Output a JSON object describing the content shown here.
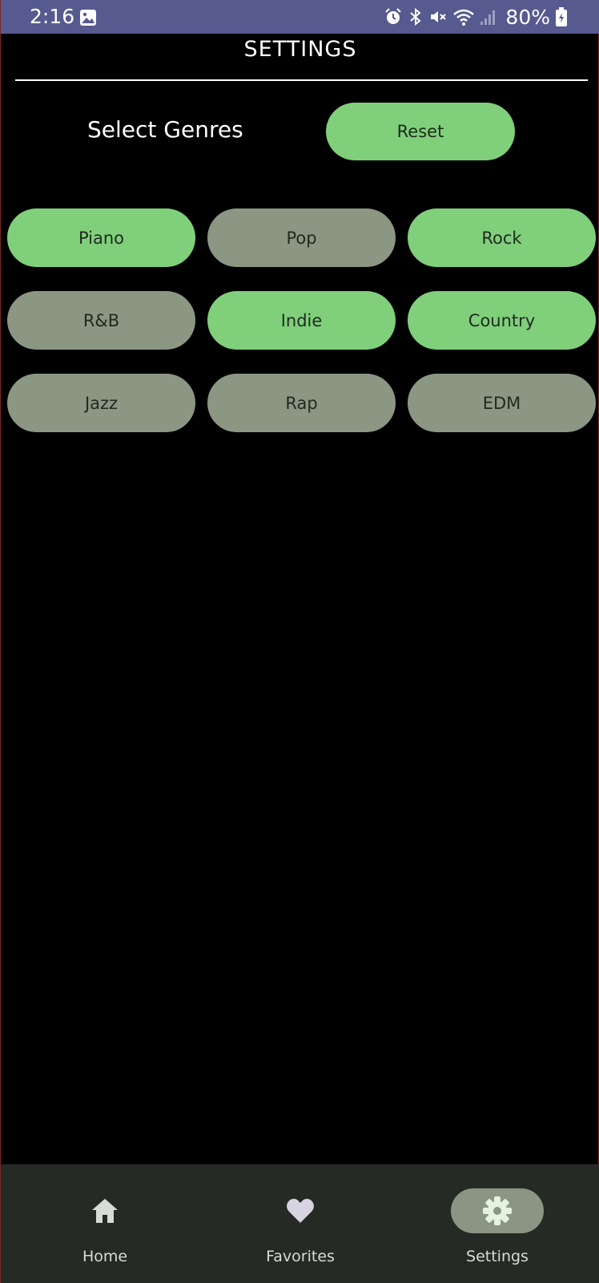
{
  "status_bar": {
    "time": "2:16",
    "battery": "80%",
    "icons": [
      "image-icon",
      "alarm-icon",
      "bluetooth-icon",
      "mute-icon",
      "wifi-icon",
      "signal-icon",
      "battery-icon"
    ]
  },
  "header": {
    "title": "SETTINGS"
  },
  "genres_section": {
    "label": "Select Genres",
    "reset_label": "Reset"
  },
  "genres": [
    {
      "label": "Piano",
      "selected": true
    },
    {
      "label": "Pop",
      "selected": false
    },
    {
      "label": "Rock",
      "selected": true
    },
    {
      "label": "R&B",
      "selected": false
    },
    {
      "label": "Indie",
      "selected": true
    },
    {
      "label": "Country",
      "selected": true
    },
    {
      "label": "Jazz",
      "selected": false
    },
    {
      "label": "Rap",
      "selected": false
    },
    {
      "label": "EDM",
      "selected": false
    }
  ],
  "bottom_nav": {
    "items": [
      {
        "label": "Home",
        "icon": "home-icon",
        "active": false
      },
      {
        "label": "Favorites",
        "icon": "heart-icon",
        "active": false
      },
      {
        "label": "Settings",
        "icon": "gear-icon",
        "active": true
      }
    ]
  },
  "colors": {
    "status_bar": "#565a8e",
    "chip_selected": "#80cf7b",
    "chip_unselected": "#8b9683",
    "nav_background": "#252a25",
    "nav_active_pill": "#8a9683"
  }
}
